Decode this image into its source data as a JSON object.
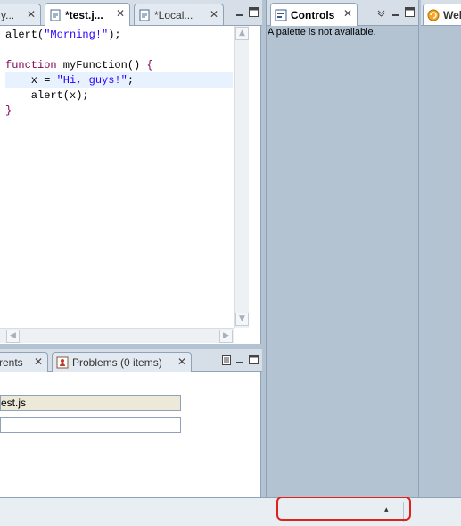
{
  "editor_tabs": [
    {
      "label": "y...",
      "active": false,
      "icon": "none"
    },
    {
      "label": "*test.j...",
      "active": true,
      "icon": "js-file-icon"
    },
    {
      "label": "*Local...",
      "active": false,
      "icon": "js-file-icon"
    }
  ],
  "code": {
    "lines": [
      {
        "parts": [
          [
            "alert(",
            "plain"
          ],
          [
            "\"Morning!\"",
            "str"
          ],
          [
            ");",
            "plain"
          ]
        ]
      },
      {
        "parts": []
      },
      {
        "parts": [
          [
            "function",
            "kw"
          ],
          [
            " myFunction() ",
            "plain"
          ],
          [
            "{",
            "kw"
          ]
        ]
      },
      {
        "parts": [
          [
            "    x = ",
            "plain"
          ],
          [
            "\"Hi, guys!\"",
            "str"
          ],
          [
            ";",
            "plain"
          ]
        ]
      },
      {
        "parts": [
          [
            "    alert(x);",
            "plain"
          ]
        ]
      },
      {
        "parts": [
          [
            "}",
            "kw"
          ]
        ]
      }
    ]
  },
  "bottom_tabs": [
    {
      "label": "rents",
      "active": false
    },
    {
      "label": "Problems (0 items)",
      "active": false,
      "icon": "problems-icon"
    }
  ],
  "bottom_fields": [
    {
      "value": "est.js"
    },
    {
      "value": ""
    }
  ],
  "controls": {
    "tab_label": "Controls",
    "message": "A palette is not available."
  },
  "welcome": {
    "tab_label": "Wel"
  },
  "status": {
    "arrow": "▴"
  },
  "colors": {
    "keyword": "#7f0055",
    "string": "#2a00ff",
    "annotation": "#e0201a"
  }
}
